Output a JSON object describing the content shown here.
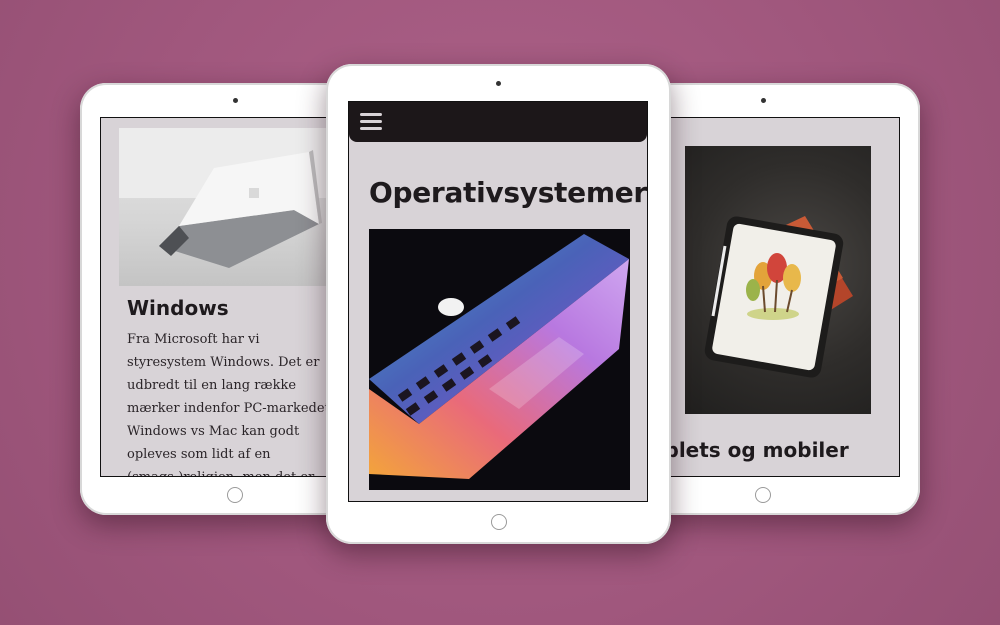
{
  "left_card": {
    "title": "Windows",
    "text": "Fra Microsoft har vi styresystem Windows. Det er udbredt til en lang række mærker indenfor PC-markedet. Windows vs Mac kan godt opleves som lidt af en (smags-)religion, men det er først og fremmest to forskellige"
  },
  "center_page": {
    "title": "Operativsystemer",
    "menu_icon": "hamburger-icon"
  },
  "right_card": {
    "title": "ablets og mobiler"
  },
  "colors": {
    "background": "#a35a80",
    "screen": "#d8d3d7",
    "navbar": "#1c1719",
    "text": "#1e1a1d"
  }
}
